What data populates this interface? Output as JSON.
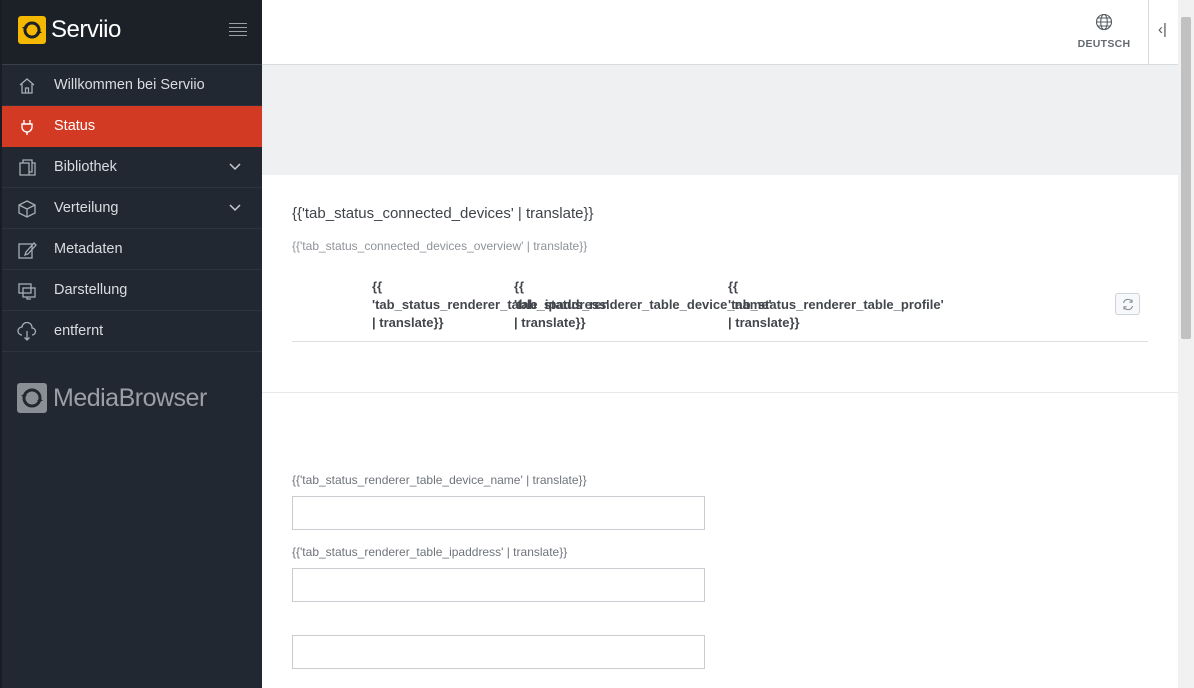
{
  "brand": {
    "name": "Serviio"
  },
  "sidebar": {
    "items": [
      {
        "label": "Willkommen bei Serviio",
        "icon": "home-icon",
        "active": false
      },
      {
        "label": "Status",
        "icon": "plug-icon",
        "active": true
      },
      {
        "label": "Bibliothek",
        "icon": "library-icon",
        "active": false,
        "expandable": true
      },
      {
        "label": "Verteilung",
        "icon": "box-icon",
        "active": false,
        "expandable": true
      },
      {
        "label": "Metadaten",
        "icon": "edit-icon",
        "active": false
      },
      {
        "label": "Darstellung",
        "icon": "display-icon",
        "active": false
      },
      {
        "label": "entfernt",
        "icon": "cloud-icon",
        "active": false
      }
    ],
    "mediabrowser": "MediaBrowser"
  },
  "header": {
    "language": "DEUTSCH",
    "collapse_glyph": "‹|"
  },
  "colors": {
    "accent": "#d33a23",
    "sidebar_bg": "#222831",
    "brand_yellow": "#f5b800"
  },
  "status": {
    "title": "{{'tab_status_connected_devices' | translate}}",
    "subtitle": "{{'tab_status_connected_devices_overview' | translate}}",
    "table": {
      "columns": [
        "{{\n'tab_status_renderer_table_ipaddress'\n| translate}}",
        "{{\n'tab_status_renderer_table_device_name'\n| translate}}",
        "{{\n'tab_status_renderer_table_profile'\n| translate}}"
      ],
      "rows": []
    }
  },
  "form": {
    "fields": [
      {
        "label": "{{'tab_status_renderer_table_device_name' | translate}}",
        "value": ""
      },
      {
        "label": "{{'tab_status_renderer_table_ipaddress' | translate}}",
        "value": ""
      },
      {
        "label": "",
        "value": ""
      }
    ]
  }
}
